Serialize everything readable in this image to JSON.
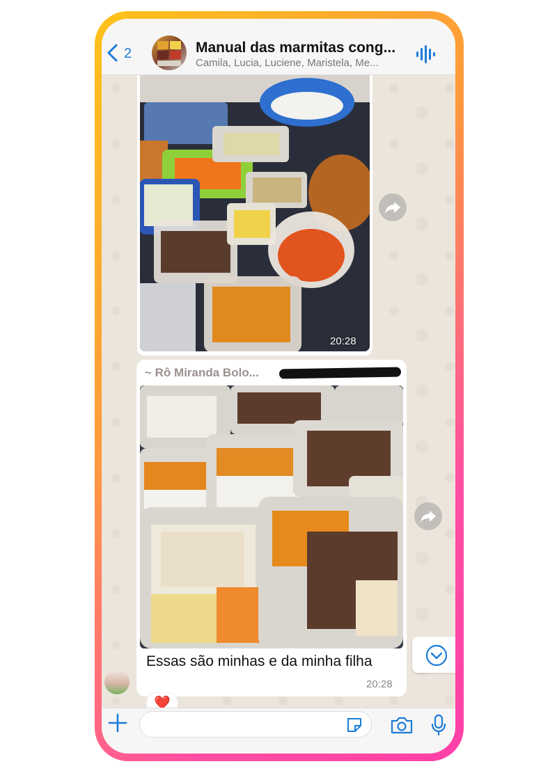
{
  "header": {
    "back_count": "2",
    "title": "Manual das marmitas cong...",
    "subtitle": "Camila, Lucia, Luciene, Maristela, Me..."
  },
  "messages": [
    {
      "type": "image",
      "image_description": "Plastic containers with chopped vegetables, rice and meat on a table",
      "time": "20:28"
    },
    {
      "type": "image",
      "sender": "~ Rô Miranda Bolo...",
      "image_description": "Many meal-prep containers with rice, chicken, squash and ground beef",
      "caption": "Essas são minhas e da minha filha",
      "time": "20:28",
      "reaction": "❤️"
    }
  ],
  "composer": {
    "placeholder": ""
  },
  "colors": {
    "accent": "#1a7bd8",
    "frame_start": "#ffc21a",
    "frame_end": "#ff3fa8",
    "chat_bg": "#ebe5dc"
  }
}
